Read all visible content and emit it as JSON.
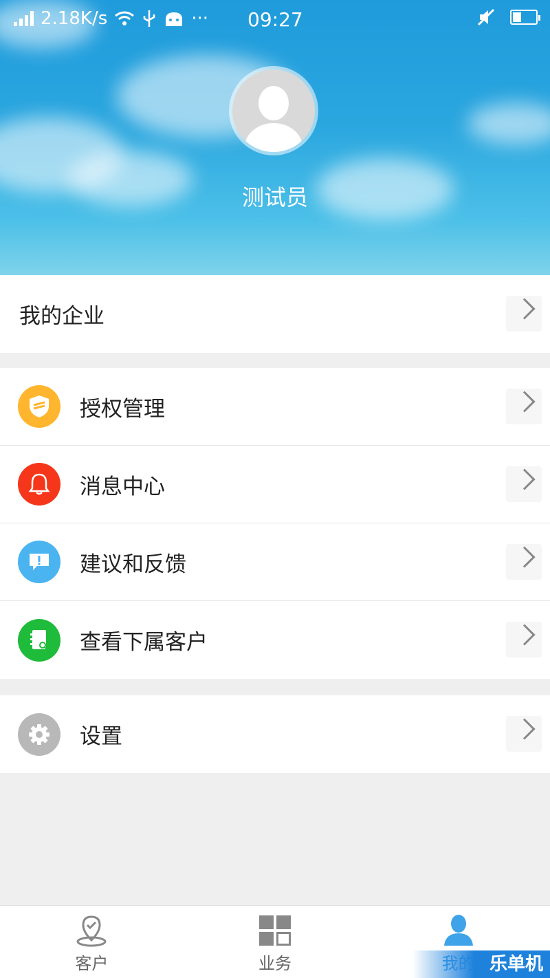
{
  "status_bar": {
    "speed": "2.18K/s",
    "time": "09:27",
    "more": "···"
  },
  "profile": {
    "username": "测试员"
  },
  "company_row": {
    "label": "我的企业"
  },
  "menu": [
    {
      "label": "授权管理",
      "icon": "shield-icon",
      "color": "#ffb52e"
    },
    {
      "label": "消息中心",
      "icon": "bell-icon",
      "color": "#f5361a"
    },
    {
      "label": "建议和反馈",
      "icon": "feedback-icon",
      "color": "#49b4f0"
    },
    {
      "label": "查看下属客户",
      "icon": "contacts-icon",
      "color": "#1fbb3a"
    }
  ],
  "settings_row": {
    "label": "设置",
    "icon": "gear-icon",
    "color": "#b8b8b8"
  },
  "tabs": [
    {
      "label": "客户",
      "icon": "location-icon",
      "active": false
    },
    {
      "label": "业务",
      "icon": "grid-icon",
      "active": false
    },
    {
      "label": "我的",
      "icon": "person-icon",
      "active": true
    }
  ],
  "watermark": "乐单机",
  "colors": {
    "accent": "#3ea3e8",
    "header_sky": "#2aa6df"
  }
}
